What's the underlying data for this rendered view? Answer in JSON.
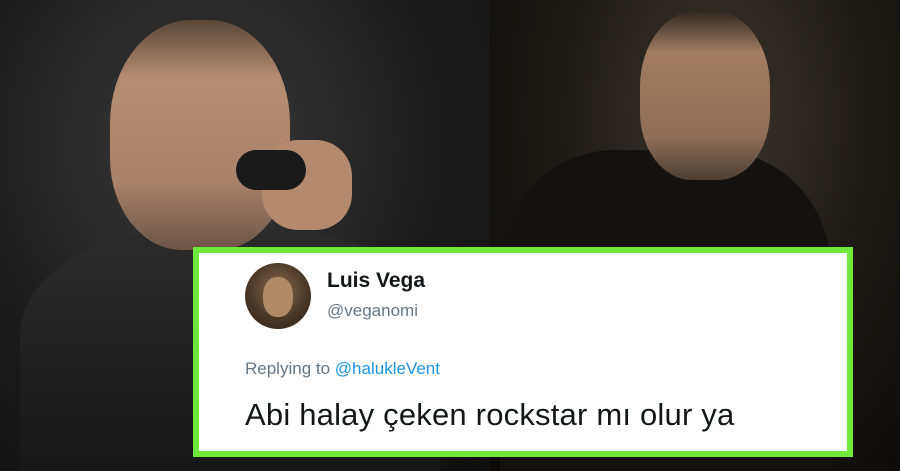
{
  "tweet": {
    "display_name": "Luis Vega",
    "handle": "@veganomi",
    "replying_prefix": "Replying to",
    "replying_mention": "@halukleVent",
    "text": "Abi halay çeken rockstar mı olur ya"
  },
  "colors": {
    "tweet_border": "#6ee83a",
    "mention": "#1b95e0",
    "secondary_text": "#657786"
  },
  "images": {
    "left_photo": "person-singing-with-microphone",
    "right_photo": "person-dancing-at-event",
    "avatar": "profile-avatar"
  }
}
